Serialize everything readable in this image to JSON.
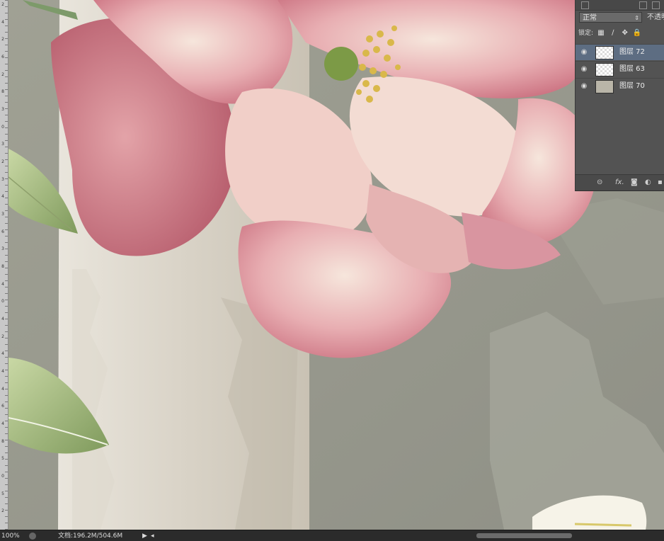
{
  "ruler": {
    "labels": [
      "2",
      "4",
      "2",
      "6",
      "2",
      "8",
      "3",
      "0",
      "3",
      "2",
      "3",
      "4",
      "3",
      "6",
      "3",
      "8",
      "4",
      "0",
      "4",
      "2",
      "4",
      "4",
      "4",
      "6",
      "4",
      "8",
      "5",
      "0",
      "5",
      "2"
    ]
  },
  "layers_panel": {
    "blend_mode": "正常",
    "opacity_label": "不透明",
    "lock_label": "锁定:",
    "layers": [
      {
        "name": "图层 72",
        "selected": true,
        "visible": true
      },
      {
        "name": "图层 63",
        "selected": false,
        "visible": true
      },
      {
        "name": "图层 70",
        "selected": false,
        "visible": true
      }
    ],
    "footer_icons": [
      "link-icon",
      "fx-icon",
      "mask-icon",
      "adjustment-icon",
      "new-layer-icon"
    ]
  },
  "status_bar": {
    "zoom": "100%",
    "doc_info": "文档:196.2M/504.6M",
    "arrow": "▶",
    "dot": "◂"
  },
  "colors": {
    "background_wall": "#9a9a8e",
    "panel": "#535353",
    "selected_layer": "#5d6d82",
    "flower_pink": "#d98a95",
    "leaf_green": "#9bb07a"
  }
}
